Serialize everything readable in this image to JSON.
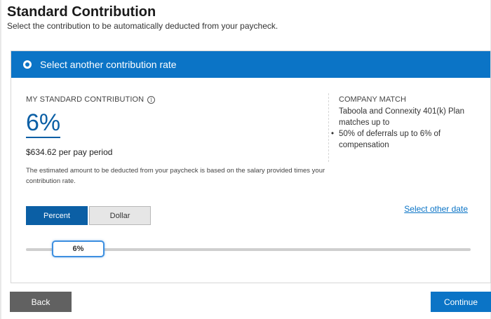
{
  "header": {
    "title": "Standard Contribution",
    "subtitle": "Select the contribution to be automatically deducted from your paycheck."
  },
  "option": {
    "label": "Select another contribution rate",
    "selected": true
  },
  "contribution": {
    "label": "MY STANDARD CONTRIBUTION",
    "info_icon": "info-icon",
    "rate": "6%",
    "per_period": "$634.62 per pay period",
    "note": "The estimated amount to be deducted from your paycheck is based on the salary provided times your contribution rate."
  },
  "company_match": {
    "title": "COMPANY MATCH",
    "text": "Taboola and Connexity 401(k) Plan matches up to",
    "items": [
      "50% of deferrals up to 6% of compensation"
    ]
  },
  "toggle": {
    "percent_label": "Percent",
    "dollar_label": "Dollar",
    "active": "Percent"
  },
  "links": {
    "select_other_date": "Select other date"
  },
  "slider": {
    "value_label": "6%",
    "value": 6
  },
  "footer": {
    "back_label": "Back",
    "continue_label": "Continue"
  },
  "colors": {
    "accent": "#0b74c6",
    "rate_text": "#0b5fa5",
    "back_button": "#616161"
  }
}
